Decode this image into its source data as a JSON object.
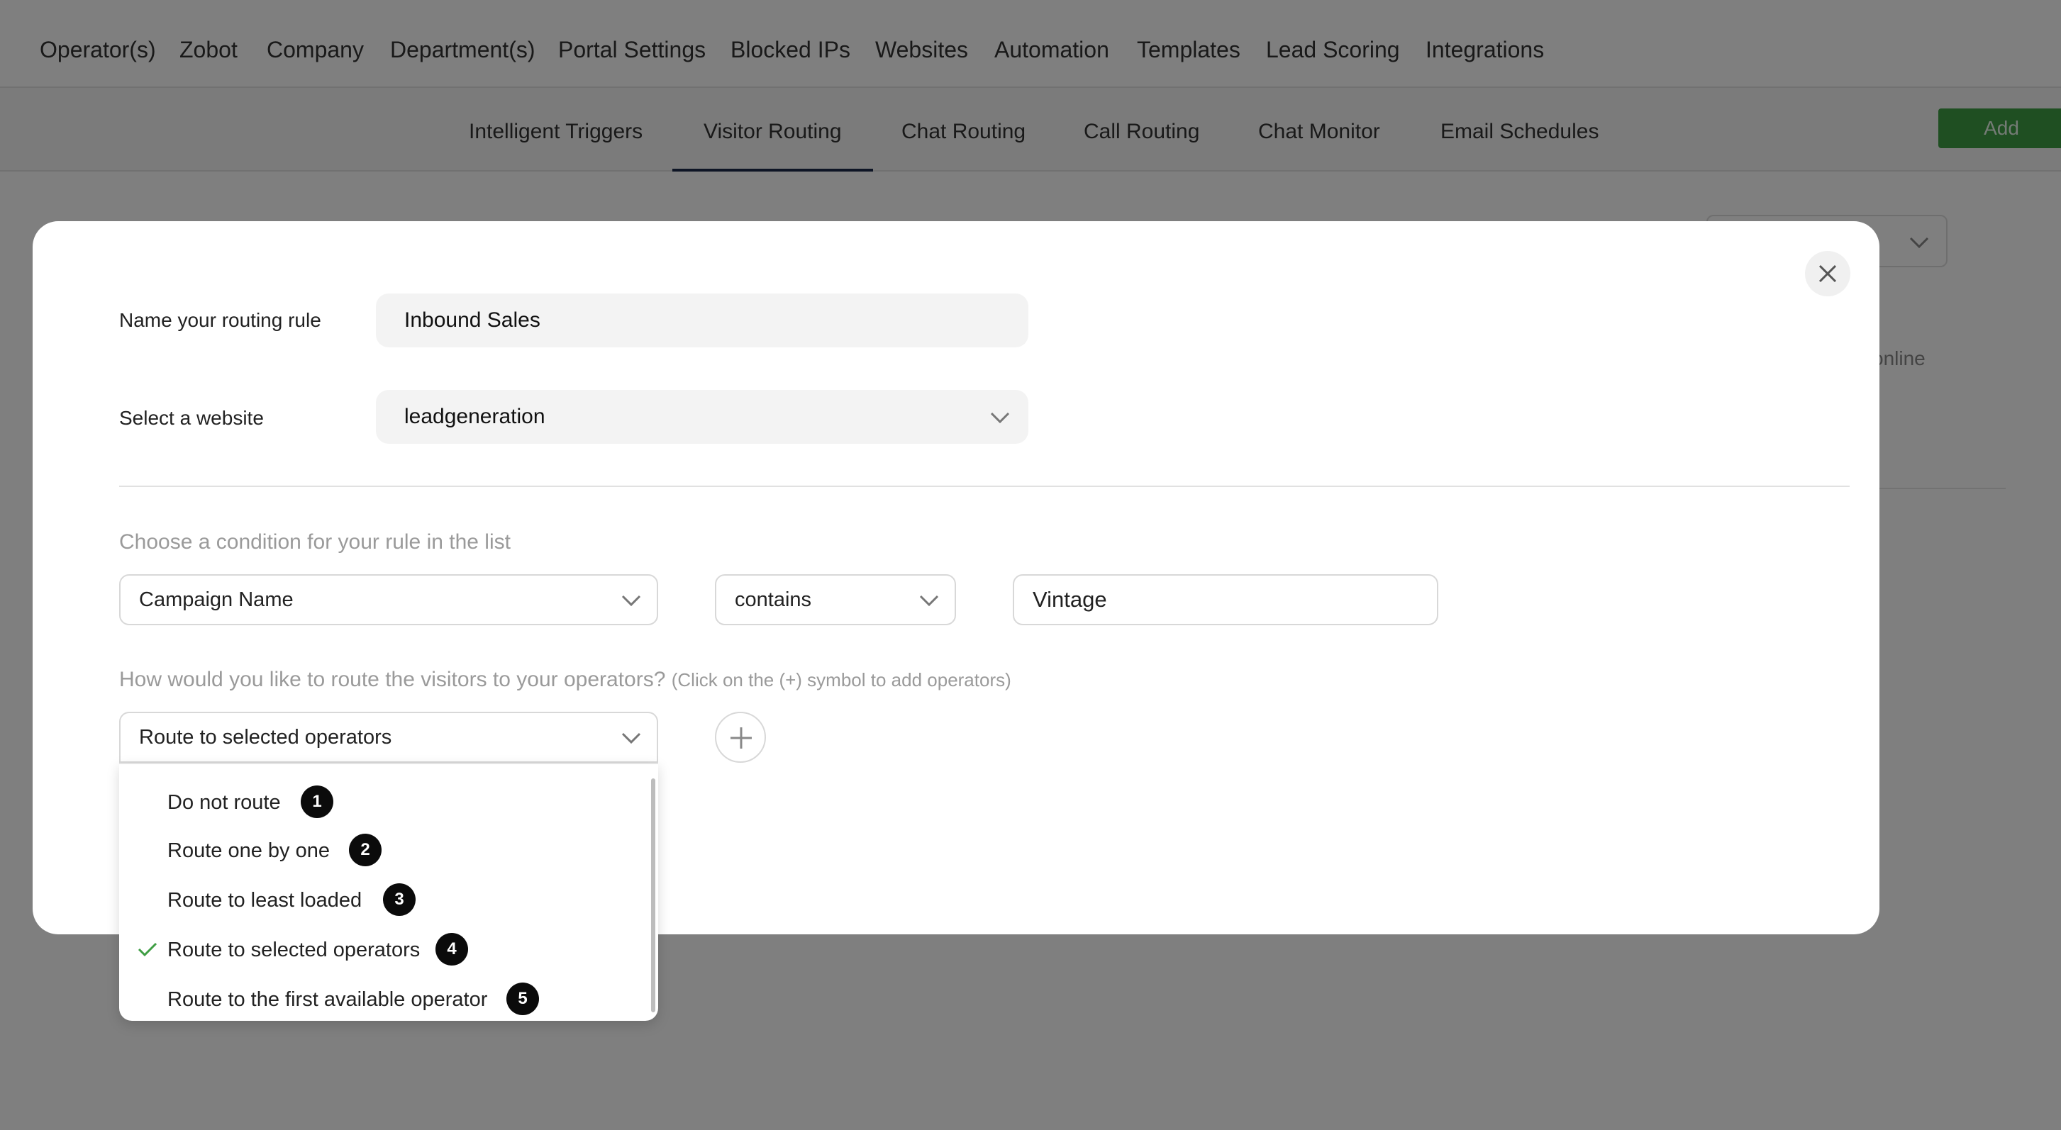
{
  "top_nav": {
    "items": [
      {
        "label": "Operator(s)",
        "active": false
      },
      {
        "label": "Zobot",
        "active": false
      },
      {
        "label": "Company",
        "active": false
      },
      {
        "label": "Department(s)",
        "active": false
      },
      {
        "label": "Portal Settings",
        "active": false
      },
      {
        "label": "Blocked IPs",
        "active": false
      },
      {
        "label": "Websites",
        "active": false
      },
      {
        "label": "Automation",
        "active": true
      },
      {
        "label": "Templates",
        "active": false
      },
      {
        "label": "Lead Scoring",
        "active": false
      },
      {
        "label": "Integrations",
        "active": false
      }
    ]
  },
  "sub_nav": {
    "items": [
      {
        "label": "Intelligent Triggers",
        "active": false
      },
      {
        "label": "Visitor Routing",
        "active": true
      },
      {
        "label": "Chat Routing",
        "active": false
      },
      {
        "label": "Call Routing",
        "active": false
      },
      {
        "label": "Chat Monitor",
        "active": false
      },
      {
        "label": "Email Schedules",
        "active": false
      }
    ],
    "add_label": "Add"
  },
  "background": {
    "status_text": "online"
  },
  "modal": {
    "name_label": "Name your routing rule",
    "name_value": "Inbound Sales",
    "website_label": "Select a website",
    "website_value": "leadgeneration",
    "condition_hint": "Choose a condition for your rule in the list",
    "condition_field": "Campaign Name",
    "condition_operator": "contains",
    "condition_value": "Vintage",
    "route_hint": "How would you like to route the visitors to your operators?",
    "route_hint_small": "(Click on the (+) symbol to add operators)",
    "route_selected": "Route to selected operators"
  },
  "dropdown": {
    "options": [
      {
        "label": "Do not route",
        "badge": "1",
        "selected": false
      },
      {
        "label": "Route one by one",
        "badge": "2",
        "selected": false
      },
      {
        "label": "Route to least loaded",
        "badge": "3",
        "selected": false
      },
      {
        "label": "Route to selected operators",
        "badge": "4",
        "selected": true
      },
      {
        "label": "Route to the first available operator",
        "badge": "5",
        "selected": false
      }
    ]
  },
  "colors": {
    "accent_green": "#3f9e44",
    "active_underline": "#1d2a4a",
    "badge": "#0b0b0b"
  },
  "icons": {
    "close": "close-icon",
    "chevron": "chevron-down-icon",
    "plus": "plus-icon",
    "check": "checkmark-icon"
  }
}
